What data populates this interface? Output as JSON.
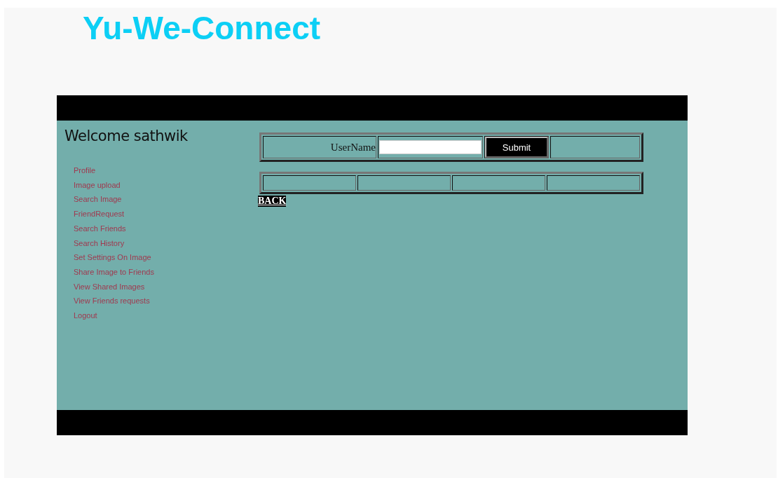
{
  "site_title": "Yu-We-Connect",
  "welcome": "Welcome sathwik",
  "menu": [
    "Profile",
    "Image upload",
    "Search Image",
    "FriendRequest",
    "Search Friends",
    "Search History",
    "Set Settings On Image",
    "Share Image to Friends",
    "View Shared Images",
    "View Friends requests",
    "Logout"
  ],
  "form": {
    "label": "UserName",
    "submit": "Submit"
  },
  "back": "BACK"
}
